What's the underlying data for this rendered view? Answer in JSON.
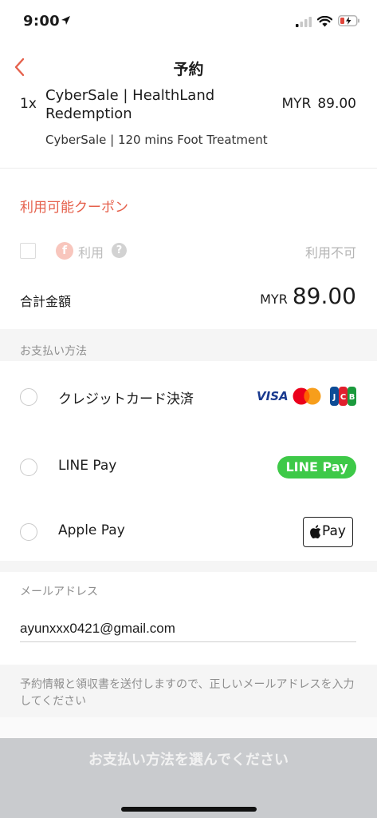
{
  "status_bar": {
    "time": "9:00"
  },
  "nav": {
    "title": "予約"
  },
  "order": {
    "quantity": "1x",
    "name": "CyberSale | HealthLand Redemption",
    "currency": "MYR",
    "price": "89.00",
    "description": "CyberSale | 120 mins Foot Treatment"
  },
  "coupon": {
    "heading": "利用可能クーポン",
    "icon_letter": "f",
    "use_label": "利用",
    "help_symbol": "?",
    "status": "利用不可"
  },
  "total": {
    "label": "合計金額",
    "currency": "MYR",
    "amount": "89.00"
  },
  "payment": {
    "section_label": "お支払い方法",
    "options": [
      {
        "label": "クレジットカード決済",
        "logos": [
          "VISA",
          "mastercard",
          "JCB"
        ]
      },
      {
        "label": "LINE Pay",
        "logo": "LINE Pay"
      },
      {
        "label": "Apple Pay",
        "logo": "Pay"
      }
    ]
  },
  "email": {
    "label": "メールアドレス",
    "value": "ayunxxx0421@gmail.com",
    "note": "予約情報と領収書を送付しますので、正しいメールアドレスを入力してください"
  },
  "submit": {
    "label": "お支払い方法を選んでください"
  },
  "colors": {
    "accent": "#e5604b",
    "line_green": "#3ec948",
    "submit_disabled": "#c9cbce"
  }
}
